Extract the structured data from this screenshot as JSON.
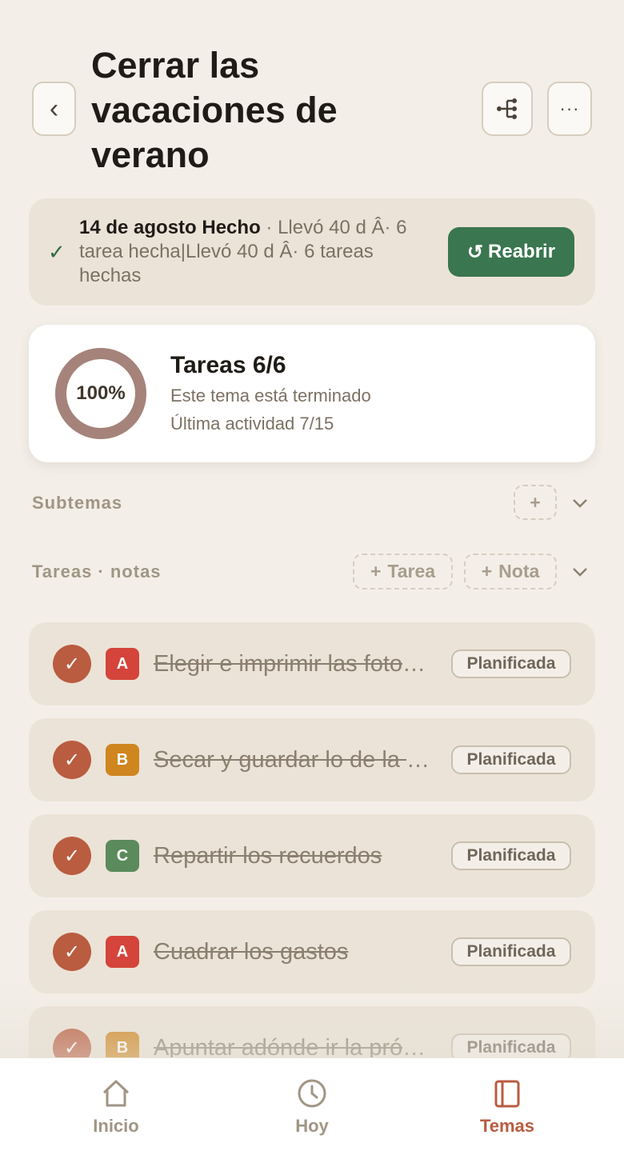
{
  "header": {
    "title": "Cerrar las vacaciones de verano",
    "back_icon": "‹",
    "more_icon": "···"
  },
  "done_banner": {
    "date_status": "14 de agosto Hecho",
    "detail": " · Llevó 40 d Â· 6 tarea hecha|Llevó 40 d Â· 6 tareas hechas",
    "check_icon": "✓",
    "reopen_icon": "↺",
    "reopen_label": "Reabrir",
    "reopen_color": "#3a7650"
  },
  "progress": {
    "percent_label": "100%",
    "fraction": 1.0,
    "title": "Tareas 6/6",
    "subtitle": "Este tema está terminado",
    "last_activity": "Última actividad 7/15"
  },
  "subtopics": {
    "label": "Subtemas",
    "add_label": "+"
  },
  "tasks_section": {
    "label": "Tareas · notas",
    "add_task_label": "Tarea",
    "add_note_label": "Nota",
    "plus": "+"
  },
  "tasks": [
    {
      "check": "✓",
      "priority": "A",
      "priority_color": "#d4443a",
      "text": "Elegir e imprimir las fotos favoritas",
      "status": "Planificada"
    },
    {
      "check": "✓",
      "priority": "B",
      "priority_color": "#cf861f",
      "text": "Secar y guardar lo de la playa",
      "status": "Planificada"
    },
    {
      "check": "✓",
      "priority": "C",
      "priority_color": "#5b8a5c",
      "text": "Repartir los recuerdos",
      "status": "Planificada"
    },
    {
      "check": "✓",
      "priority": "A",
      "priority_color": "#d4443a",
      "text": "Cuadrar los gastos",
      "status": "Planificada"
    },
    {
      "check": "✓",
      "priority": "B",
      "priority_color": "#cf861f",
      "text": "Apuntar adónde ir la próxima vez",
      "status": "Planificada"
    }
  ],
  "tabbar": {
    "items": [
      {
        "label": "Inicio",
        "icon": "home-icon"
      },
      {
        "label": "Hoy",
        "icon": "clock-icon"
      },
      {
        "label": "Temas",
        "icon": "book-icon",
        "active": true
      }
    ],
    "active_color": "#b95c40"
  }
}
